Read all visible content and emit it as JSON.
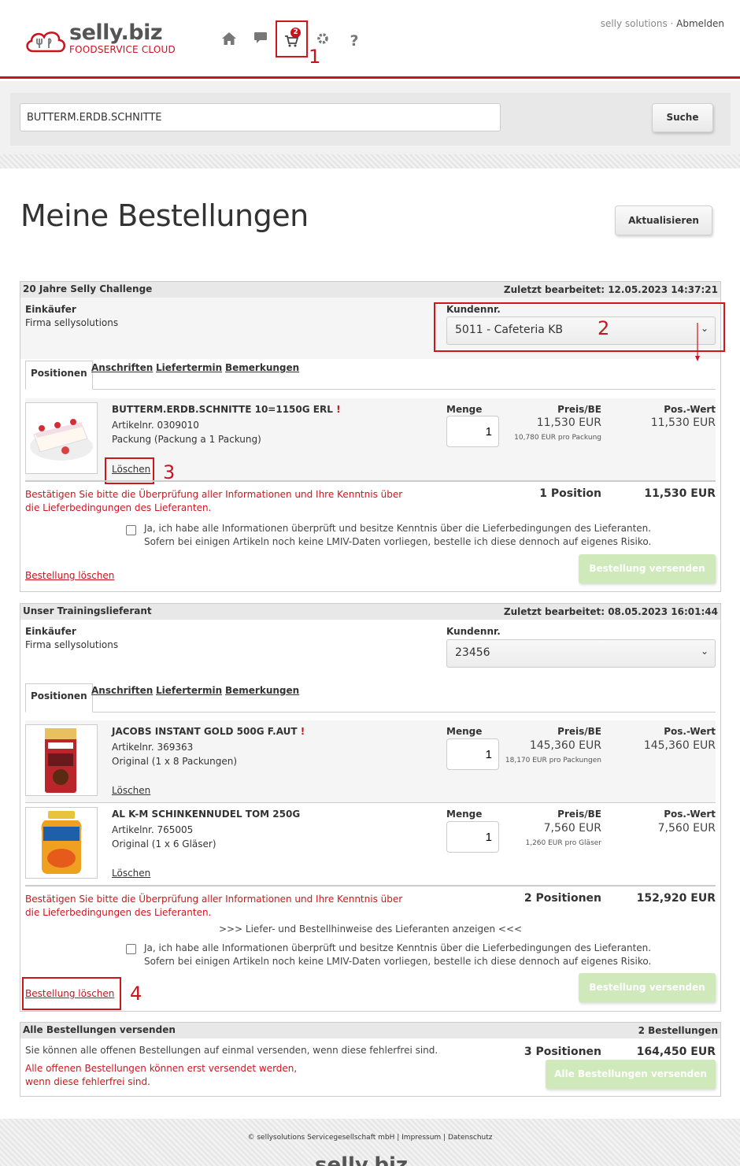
{
  "header": {
    "logo_main": "selly.biz",
    "logo_sub": "FOODSERVICE CLOUD",
    "nav_icons": [
      "home-icon",
      "chat-icon",
      "cart-icon",
      "gear-icon",
      "help-icon"
    ],
    "cart_count": "2",
    "company_link": "selly solutions ·",
    "logout_link": "Abmelden",
    "annotation_1": "1"
  },
  "search": {
    "value": "BUTTERM.ERDB.SCHNITTE",
    "button": "Suche"
  },
  "page": {
    "title": "Meine Bestellungen",
    "refresh_button": "Aktualisieren"
  },
  "orders": [
    {
      "supplier": "20 Jahre Selly Challenge",
      "last_edited": "Zuletzt bearbeitet: 12.05.2023 14:37:21",
      "buyer_label": "Einkäufer",
      "buyer_value": "Firma sellysolutions",
      "customer_label": "Kundennr.",
      "customer_value": "5011 - Cafeteria KB",
      "annotation": "2",
      "tabs": [
        "Positionen",
        "Anschriften",
        "Liefertermin",
        "Bemerkungen"
      ],
      "items": [
        {
          "name": "BUTTERM.ERDB.SCHNITTE 10=1150G ERL",
          "marker": "!",
          "article": "Artikelnr. 0309010",
          "pack": "Packung (Packung a 1 Packung)",
          "delete": "Löschen",
          "qty_label": "Menge",
          "qty": "1",
          "price_label": "Preis/BE",
          "price": "11,530 EUR",
          "unit_price": "10,780 EUR pro Packung",
          "pos_label": "Pos.-Wert",
          "pos_value": "11,530 EUR",
          "annotation": "3"
        }
      ],
      "warning": "Bestätigen Sie bitte die Überprüfung aller Informationen und Ihre Kenntnis über die Lieferbedingungen des Lieferanten.",
      "count": "1 Position",
      "total": "11,530 EUR",
      "confirm_text_1": "Ja, ich habe alle Informationen überprüft und besitze Kenntnis über die Lieferbedingungen des Lieferanten.",
      "confirm_text_2": "Sofern bei einigen Artikeln noch keine LMIV-Daten vorliegen, bestelle ich diese dennoch auf eigenes Risiko.",
      "delete_order": "Bestellung löschen",
      "send": "Bestellung versenden"
    },
    {
      "supplier": "Unser Trainingslieferant",
      "last_edited": "Zuletzt bearbeitet: 08.05.2023 16:01:44",
      "buyer_label": "Einkäufer",
      "buyer_value": "Firma sellysolutions",
      "customer_label": "Kundennr.",
      "customer_value": "23456",
      "tabs": [
        "Positionen",
        "Anschriften",
        "Liefertermin",
        "Bemerkungen"
      ],
      "items": [
        {
          "name": "JACOBS INSTANT GOLD 500G F.AUT",
          "marker": "!",
          "article": "Artikelnr. 369363",
          "pack": "Original (1 x 8 Packungen)",
          "delete": "Löschen",
          "qty_label": "Menge",
          "qty": "1",
          "price_label": "Preis/BE",
          "price": "145,360 EUR",
          "unit_price": "18,170 EUR pro Packungen",
          "pos_label": "Pos.-Wert",
          "pos_value": "145,360 EUR"
        },
        {
          "name": "AL K-M SCHINKENNUDEL TOM 250G",
          "article": "Artikelnr. 765005",
          "pack": "Original (1 x 6 Gläser)",
          "delete": "Löschen",
          "qty_label": "Menge",
          "qty": "1",
          "price_label": "Preis/BE",
          "price": "7,560 EUR",
          "unit_price": "1,260 EUR pro Gläser",
          "pos_label": "Pos.-Wert",
          "pos_value": "7,560 EUR"
        }
      ],
      "warning": "Bestätigen Sie bitte die Überprüfung aller Informationen und Ihre Kenntnis über die Lieferbedingungen des Lieferanten.",
      "count": "2 Positionen",
      "total": "152,920 EUR",
      "hint_link": ">>> Liefer- und Bestellhinweise des Lieferanten anzeigen <<<",
      "confirm_text_1": "Ja, ich habe alle Informationen überprüft und besitze Kenntnis über die Lieferbedingungen des Lieferanten.",
      "confirm_text_2": "Sofern bei einigen Artikeln noch keine LMIV-Daten vorliegen, bestelle ich diese dennoch auf eigenes Risiko.",
      "delete_order": "Bestellung löschen",
      "send": "Bestellung versenden",
      "annotation": "4"
    }
  ],
  "send_all": {
    "title": "Alle Bestellungen versenden",
    "count_orders": "2 Bestellungen",
    "info": "Sie können alle offenen Bestellungen auf einmal versenden, wenn diese fehlerfrei sind.",
    "warning_1": "Alle offenen Bestellungen können erst versendet werden,",
    "warning_2": "wenn diese fehlerfrei sind.",
    "count": "3 Positionen",
    "total": "164,450 EUR",
    "button": "Alle Bestellungen versenden"
  },
  "footer": {
    "copyright": "© sellysolutions Servicegesellschaft mbH",
    "sep": "|",
    "impressum": "Impressum",
    "datenschutz": "Datenschutz",
    "logo": "selly.biz"
  },
  "colors": {
    "brand_red": "#c8141e",
    "send_green": "#cfe9bb"
  }
}
